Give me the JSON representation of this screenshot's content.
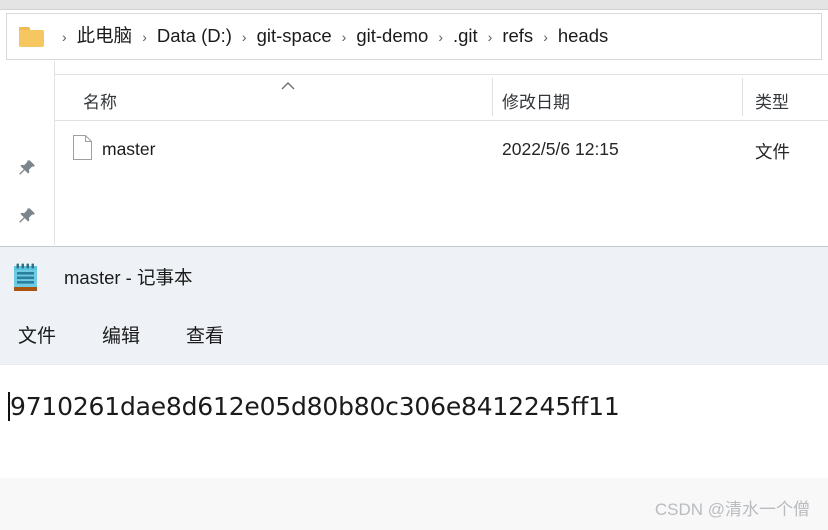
{
  "explorer": {
    "window_name": "file-explorer",
    "folder_icon": "folder-icon",
    "breadcrumb": {
      "separator": "›",
      "items": [
        {
          "label": "此电脑"
        },
        {
          "label": "Data (D:)"
        },
        {
          "label": "git-space"
        },
        {
          "label": "git-demo"
        },
        {
          "label": ".git"
        },
        {
          "label": "refs"
        },
        {
          "label": "heads"
        }
      ]
    },
    "nav_rail": {
      "pins": [
        {
          "icon": "pin-icon"
        },
        {
          "icon": "pin-icon"
        }
      ]
    },
    "columns": [
      {
        "key": "name",
        "label": "名称",
        "sorted": "asc",
        "sort_icon": "chevron-up-icon"
      },
      {
        "key": "date",
        "label": "修改日期"
      },
      {
        "key": "type",
        "label": "类型"
      }
    ],
    "rows": [
      {
        "icon": "file-icon",
        "name": "master",
        "date": "2022/5/6 12:15",
        "type": "文件"
      }
    ]
  },
  "notepad": {
    "window_name": "notepad",
    "icon": "notepad-icon",
    "title": "master - 记事本",
    "menu": [
      {
        "label": "文件"
      },
      {
        "label": "编辑"
      },
      {
        "label": "查看"
      }
    ],
    "document": {
      "content": "9710261dae8d612e05d80b80c306e8412245ff11",
      "caret_visible": true
    }
  },
  "watermark": {
    "text": "CSDN @清水一个僧"
  },
  "colors": {
    "folder": "#f6c760",
    "notepad_chrome": "#eef2f6",
    "notepad_icon": "#5bc4de",
    "pin": "#7d858c",
    "watermark": "#b9bcc0",
    "text": "#1b1b1b"
  }
}
